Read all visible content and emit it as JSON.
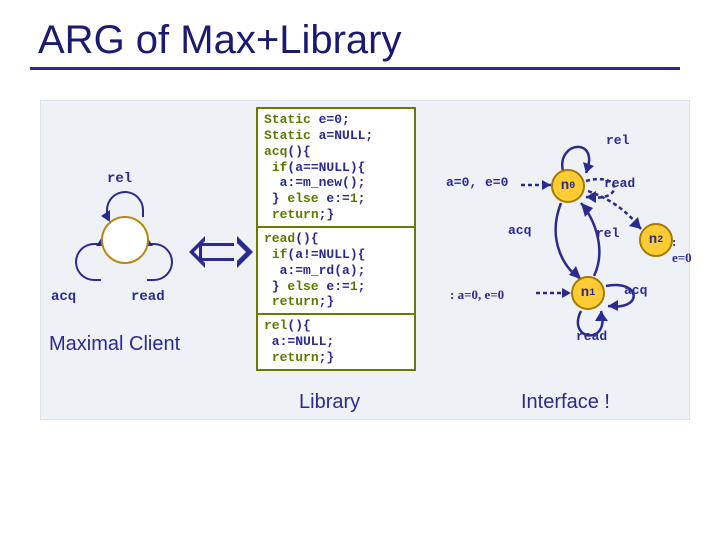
{
  "title": "ARG of Max+Library",
  "left": {
    "rel": "rel",
    "acq": "acq",
    "read": "read",
    "caption": "Maximal Client"
  },
  "code": {
    "block1": "Static e=0;\nStatic a=NULL;\nacq(){\n if(a==NULL){\n  a:=m_new();\n } else e:=1;\n return;}",
    "block2": "read(){\n if(a!=NULL){\n  a:=m_rd(a);\n } else e:=1;\n return;}",
    "block3": "rel(){\n a:=NULL;\n return;}",
    "caption": "Library"
  },
  "iface": {
    "n0": "n",
    "n0_sub": "0",
    "n1": "n",
    "n1_sub": "1",
    "n2": "n",
    "n2_sub": "2",
    "rel": "rel",
    "read": "read",
    "acq": "acq",
    "ae0": "a=0, e=0",
    "ae0_pred": ": a=0, e=0",
    "e0_pred": ": e=0",
    "caption": "Interface !"
  }
}
